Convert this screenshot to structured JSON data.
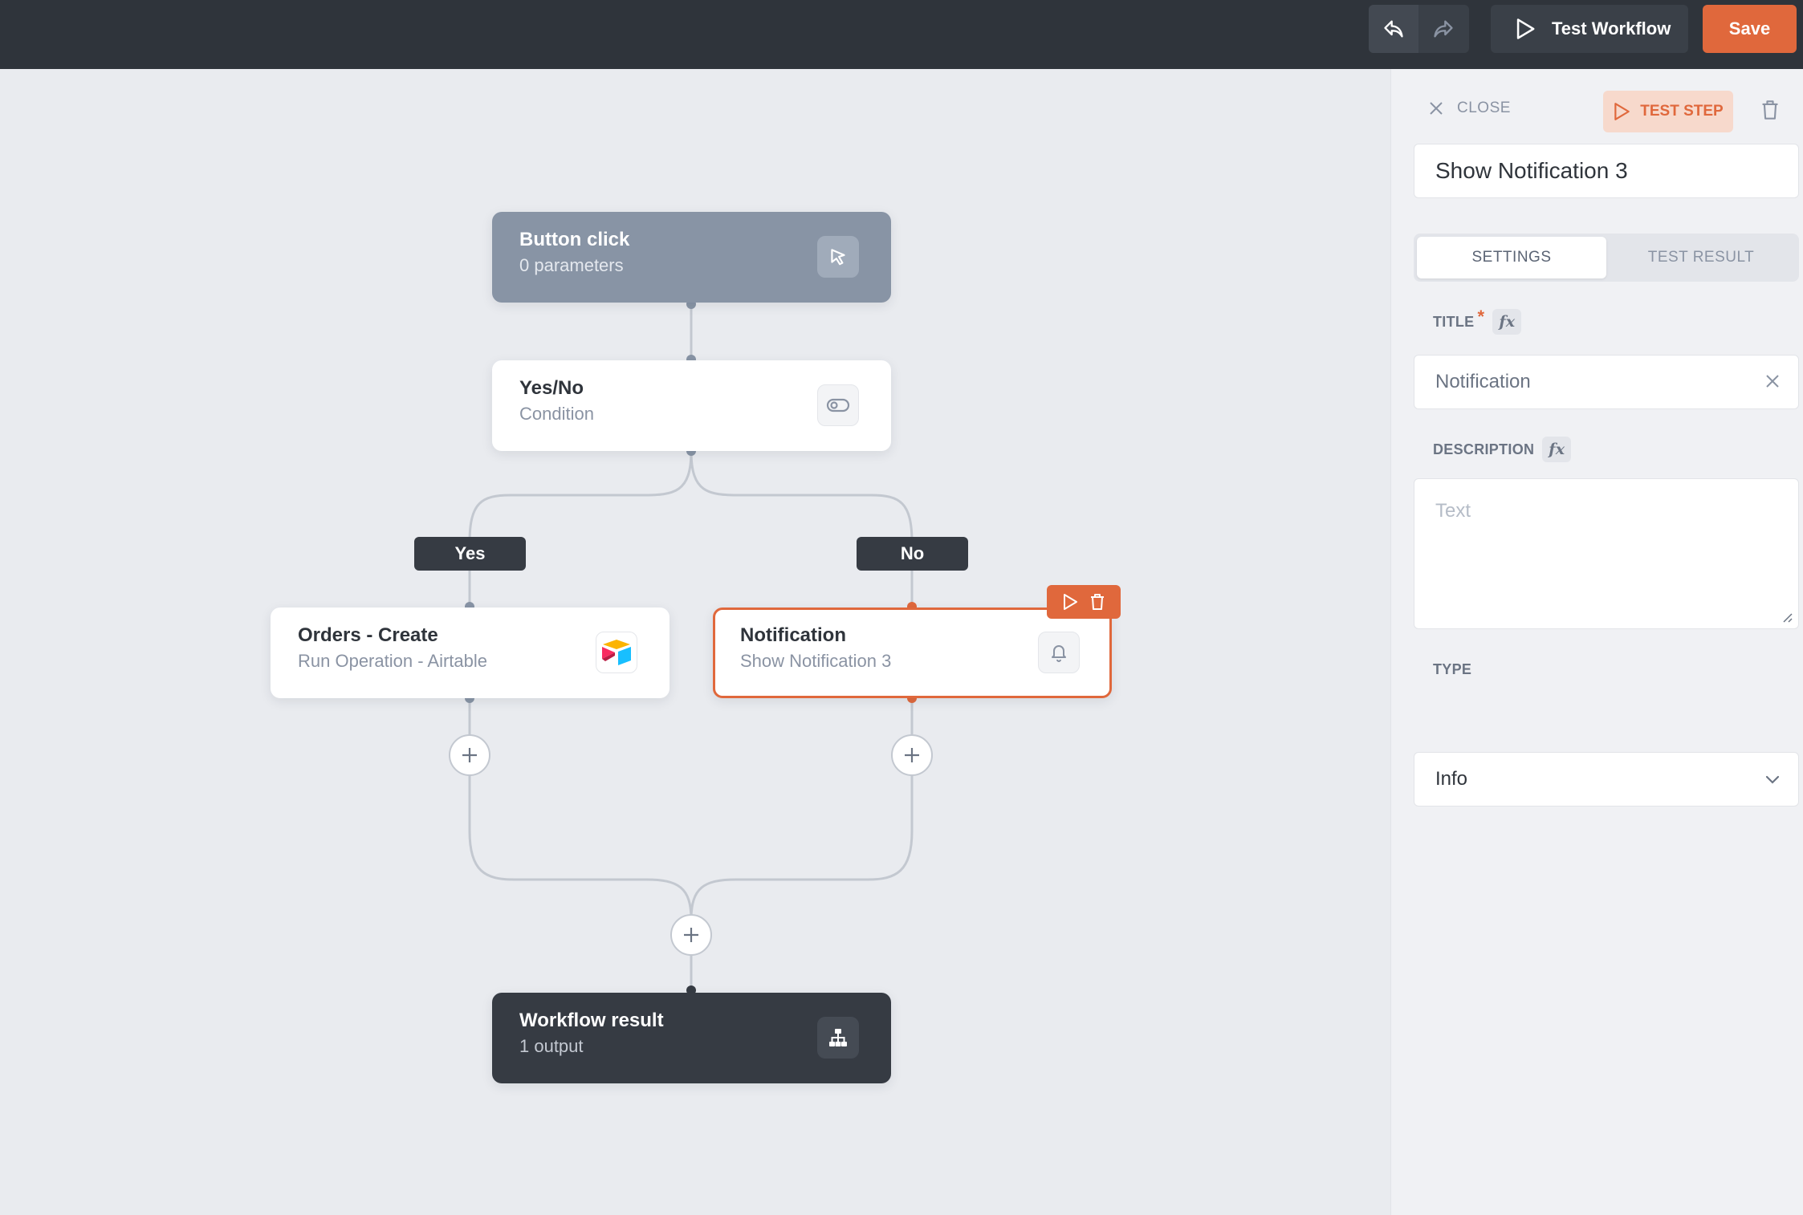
{
  "topbar": {
    "test_workflow_label": "Test Workflow",
    "save_label": "Save"
  },
  "canvas": {
    "nodes": {
      "trigger": {
        "title": "Button click",
        "subtitle": "0 parameters",
        "icon": "cursor-click-icon"
      },
      "condition": {
        "title": "Yes/No",
        "subtitle": "Condition",
        "icon": "toggle-icon"
      },
      "orders": {
        "title": "Orders - Create",
        "subtitle": "Run Operation - Airtable",
        "icon": "airtable-logo-icon"
      },
      "notification": {
        "title": "Notification",
        "subtitle": "Show Notification 3",
        "icon": "bell-icon",
        "selected": true
      },
      "result": {
        "title": "Workflow result",
        "subtitle": "1 output",
        "icon": "sitemap-icon"
      }
    },
    "branches": {
      "yes": "Yes",
      "no": "No"
    }
  },
  "panel": {
    "close_label": "CLOSE",
    "test_step_label": "TEST STEP",
    "step_name": "Show Notification 3",
    "tabs": [
      {
        "label": "SETTINGS",
        "active": true
      },
      {
        "label": "TEST RESULT",
        "active": false
      }
    ],
    "fields": {
      "title": {
        "label": "TITLE",
        "required_mark": "*",
        "fx": "fx",
        "value": "Notification"
      },
      "description": {
        "label": "DESCRIPTION",
        "fx": "fx",
        "placeholder": "Text"
      },
      "type": {
        "label": "TYPE",
        "value": "Info"
      }
    }
  },
  "colors": {
    "accent": "#e0683c",
    "topbar": "#2f343b",
    "canvas": "#e9ebef",
    "trigger_node": "#8894a5",
    "result_node": "#363b43"
  }
}
